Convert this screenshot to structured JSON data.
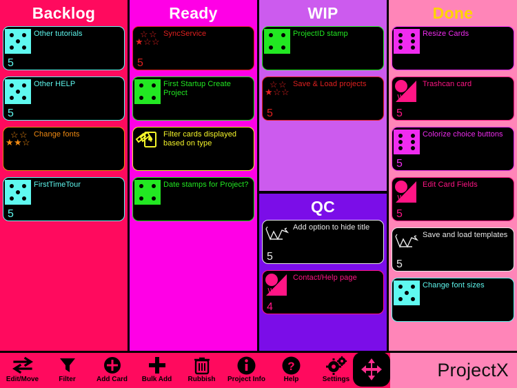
{
  "app": {
    "brand": "ProjectX"
  },
  "colors": {
    "backlog_bg": "#FF0A5E",
    "ready_bg": "#FF00E6",
    "wip_bg": "#CC5BEE",
    "qc_bg": "#7B0DE8",
    "done_bg": "#FF85B8",
    "toolbar_bg": "#FF0A5E",
    "cyan": "#5FF9F0",
    "green": "#22E822",
    "magenta": "#F02CF0",
    "red": "#E02020",
    "orange": "#F08A12",
    "yellow": "#F5F52A",
    "white": "#E8E8E8",
    "pink": "#FF1585"
  },
  "columns": [
    {
      "id": "backlog",
      "title": "Backlog",
      "title_color": "#FFFFFF",
      "bg": "#FF0A5E",
      "cards": [
        {
          "title": "Other tutorials",
          "count": "5",
          "badge": "dice-5",
          "accent": "#5FF9F0"
        },
        {
          "title": "Other HELP",
          "count": "5",
          "badge": "dice-5",
          "accent": "#5FF9F0"
        },
        {
          "title": "Change fonts",
          "count": "",
          "badge": "stars",
          "accent": "#F08A12",
          "filled_stars": 2
        },
        {
          "title": "FirstTimeTour",
          "count": "5",
          "badge": "dice-5",
          "accent": "#5FF9F0"
        }
      ]
    },
    {
      "id": "ready",
      "title": "Ready",
      "title_color": "#FFFFFF",
      "bg": "#FF00E6",
      "cards": [
        {
          "title": "SyncService",
          "count": "5",
          "badge": "stars",
          "accent": "#E02020",
          "filled_stars": 1
        },
        {
          "title": "First Startup Create Project",
          "count": "",
          "badge": "dice-4",
          "accent": "#22E822"
        },
        {
          "title": "Filter cards displayed based on type",
          "count": "",
          "badge": "card-stack",
          "accent": "#F5F52A"
        },
        {
          "title": "Date stamps for Project?",
          "count": "",
          "badge": "dice-4",
          "accent": "#22E822"
        }
      ]
    },
    {
      "id": "wip",
      "title": "WIP",
      "title_color": "#FFFFFF",
      "bg": "#CC5BEE",
      "cards": [
        {
          "title": "ProjectID stamp",
          "count": "",
          "badge": "dice-4",
          "accent": "#22E822"
        },
        {
          "title": "Save & Load projects",
          "count": "5",
          "badge": "stars",
          "accent": "#E02020",
          "filled_stars": 1
        }
      ]
    },
    {
      "id": "qc",
      "title": "QC",
      "title_color": "#FFFFFF",
      "bg": "#7B0DE8",
      "cards": [
        {
          "title": "Add option to hide title",
          "count": "5",
          "badge": "crown",
          "accent": "#E8E8E8"
        },
        {
          "title": "Contact/Help page",
          "count": "4",
          "badge": "trashcan",
          "accent": "#FF1585"
        }
      ]
    },
    {
      "id": "done",
      "title": "Done",
      "title_color": "#FFD400",
      "bg": "#FF85B8",
      "cards": [
        {
          "title": "Resize Cards",
          "count": "",
          "badge": "dice-6",
          "accent": "#F02CF0"
        },
        {
          "title": "Trashcan card",
          "count": "5",
          "badge": "trashcan",
          "accent": "#FF1585"
        },
        {
          "title": "Colorize choice buttons",
          "count": "5",
          "badge": "dice-6",
          "accent": "#F02CF0"
        },
        {
          "title": "Edit Card Fields",
          "count": "5",
          "badge": "trashcan",
          "accent": "#FF1585"
        },
        {
          "title": "Save and load templates",
          "count": "5",
          "badge": "crown",
          "accent": "#E8E8E8"
        },
        {
          "title": "Change font sizes",
          "count": "",
          "badge": "dice-5",
          "accent": "#5FF9F0"
        }
      ]
    }
  ],
  "toolbar": {
    "items": [
      {
        "label": "Edit/Move",
        "icon": "swap-arrows-icon"
      },
      {
        "label": "Filter",
        "icon": "funnel-icon"
      },
      {
        "label": "Add Card",
        "icon": "plus-circle-icon"
      },
      {
        "label": "Bulk Add",
        "icon": "plus-icon"
      },
      {
        "label": "Rubbish",
        "icon": "trash-icon"
      },
      {
        "label": "Project Info",
        "icon": "info-circle-icon"
      },
      {
        "label": "Help",
        "icon": "question-circle-icon"
      },
      {
        "label": "Settings",
        "icon": "gears-icon"
      }
    ],
    "move_handle_icon": "move-arrows-icon"
  }
}
